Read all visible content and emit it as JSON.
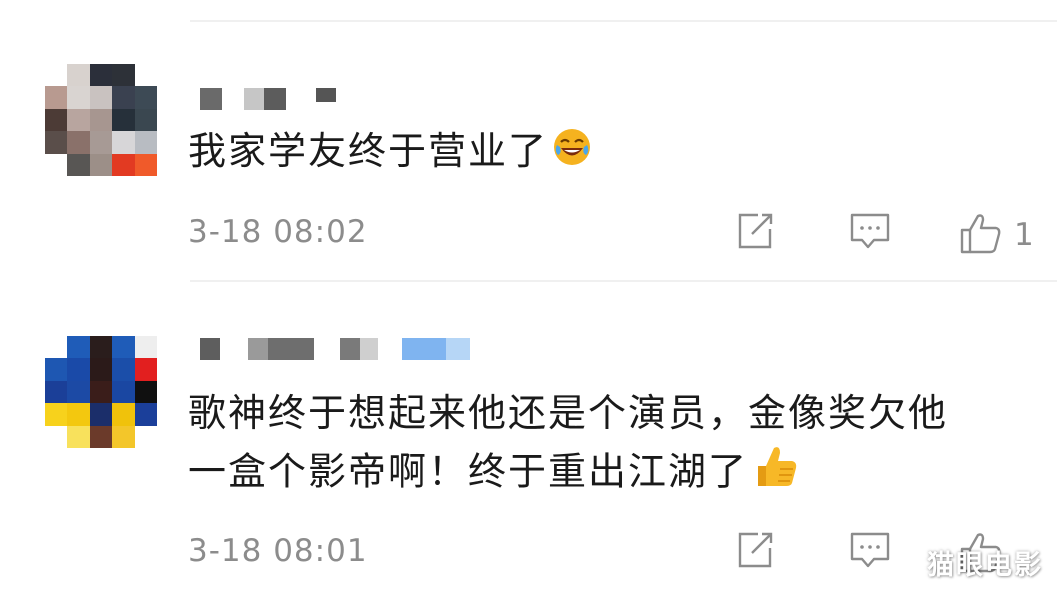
{
  "comments": [
    {
      "text": "我家学友终于营业了",
      "emoji_icon": "laughing-tears-icon",
      "timestamp": "3-18 08:02",
      "share_icon": "share-icon",
      "reply_icon": "comment-icon",
      "like_icon": "thumbs-up-icon",
      "like_count": "1"
    },
    {
      "line1": "歌神终于想起来他还是个演员，金像奖欠他",
      "line2": "一盒个影帝啊！终于重出江湖了",
      "emoji_icon": "thumbs-up-emoji-icon",
      "timestamp": "3-18 08:01",
      "share_icon": "share-icon",
      "reply_icon": "comment-icon",
      "like_icon": "thumbs-up-icon"
    }
  ],
  "watermark": "猫眼电影",
  "colors": {
    "text": "#1a1a1a",
    "meta": "#8c8c8c",
    "emoji_yellow": "#f5b21f"
  }
}
